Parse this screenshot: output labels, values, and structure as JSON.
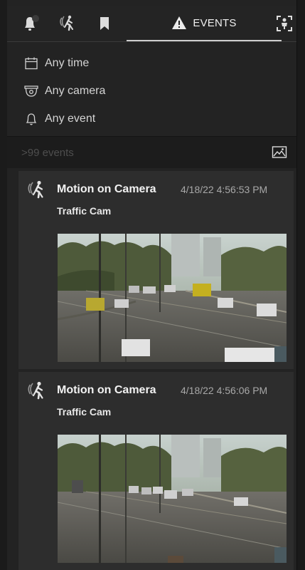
{
  "tabs": {
    "notifications": {
      "icon": "bell-alert-icon"
    },
    "motion": {
      "icon": "motion-icon"
    },
    "bookmarks": {
      "icon": "bookmark-icon"
    },
    "events": {
      "icon": "warning-icon",
      "label": "EVENTS"
    },
    "person_detect": {
      "icon": "person-detect-icon"
    }
  },
  "filters": {
    "time": {
      "icon": "calendar-icon",
      "label": "Any time"
    },
    "camera": {
      "icon": "camera-dome-icon",
      "label": "Any camera"
    },
    "event": {
      "icon": "bell-outline-icon",
      "label": "Any event"
    }
  },
  "events_count": ">99 events",
  "thumbnail_toggle_icon": "image-toggle-icon",
  "events": [
    {
      "icon": "motion-icon",
      "title": "Motion on Camera",
      "time": "4/18/22 4:56:53 PM",
      "camera": "Traffic Cam",
      "thumbnail_icon": "traffic-camera-frame"
    },
    {
      "icon": "motion-icon",
      "title": "Motion on Camera",
      "time": "4/18/22 4:56:06 PM",
      "camera": "Traffic Cam",
      "thumbnail_icon": "traffic-camera-frame"
    }
  ],
  "colors": {
    "background": "#232323",
    "card": "#2d2d2d",
    "text": "#f2f2f2",
    "muted": "#a8a8a8"
  }
}
